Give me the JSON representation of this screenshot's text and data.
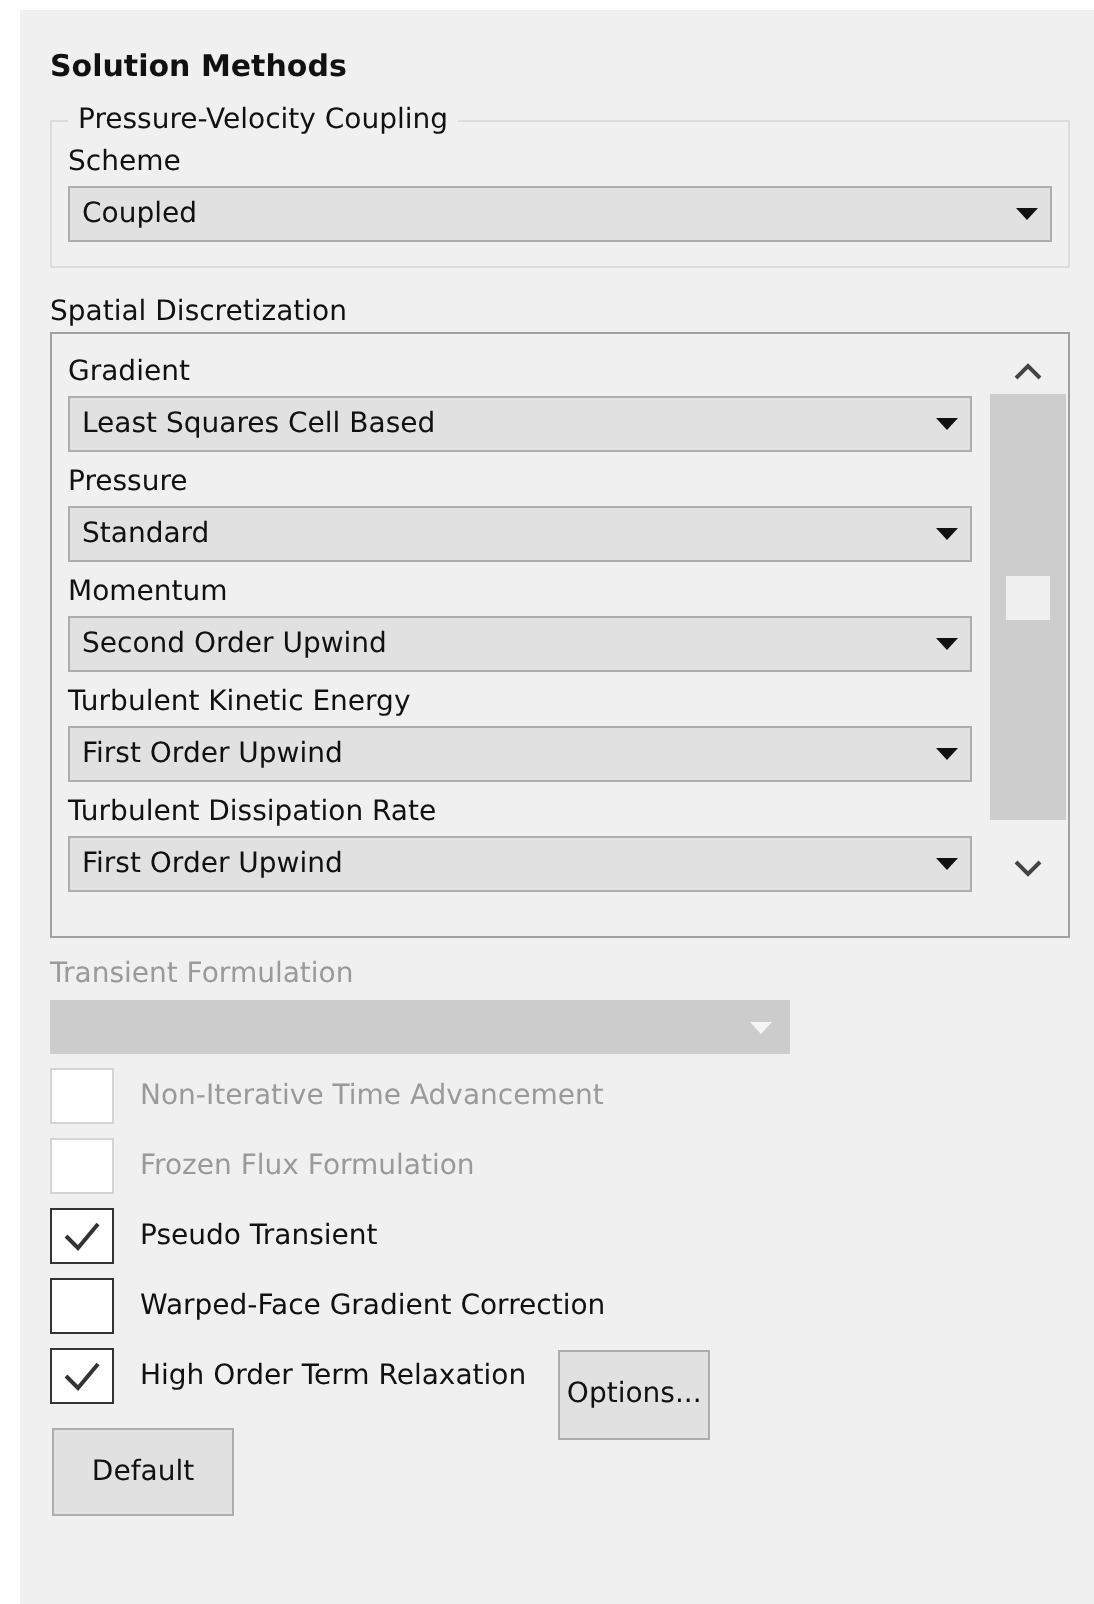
{
  "title": "Solution Methods",
  "coupling": {
    "legend": "Pressure-Velocity Coupling",
    "label": "Scheme",
    "value": "Coupled"
  },
  "spatial": {
    "label": "Spatial Discretization",
    "items": [
      {
        "label": "Gradient",
        "value": "Least Squares Cell Based"
      },
      {
        "label": "Pressure",
        "value": "Standard"
      },
      {
        "label": "Momentum",
        "value": "Second Order Upwind"
      },
      {
        "label": "Turbulent Kinetic Energy",
        "value": "First Order Upwind"
      },
      {
        "label": "Turbulent Dissipation Rate",
        "value": "First Order Upwind"
      }
    ]
  },
  "transient": {
    "label": "Transient Formulation",
    "disabled": true
  },
  "options": [
    {
      "label": "Non-Iterative Time Advancement",
      "checked": false,
      "disabled": true
    },
    {
      "label": "Frozen Flux Formulation",
      "checked": false,
      "disabled": true
    },
    {
      "label": "Pseudo Transient",
      "checked": true,
      "disabled": false
    },
    {
      "label": "Warped-Face Gradient Correction",
      "checked": false,
      "disabled": false
    },
    {
      "label": "High Order Term Relaxation",
      "checked": true,
      "disabled": false,
      "button": "Options..."
    }
  ],
  "default_button": "Default"
}
